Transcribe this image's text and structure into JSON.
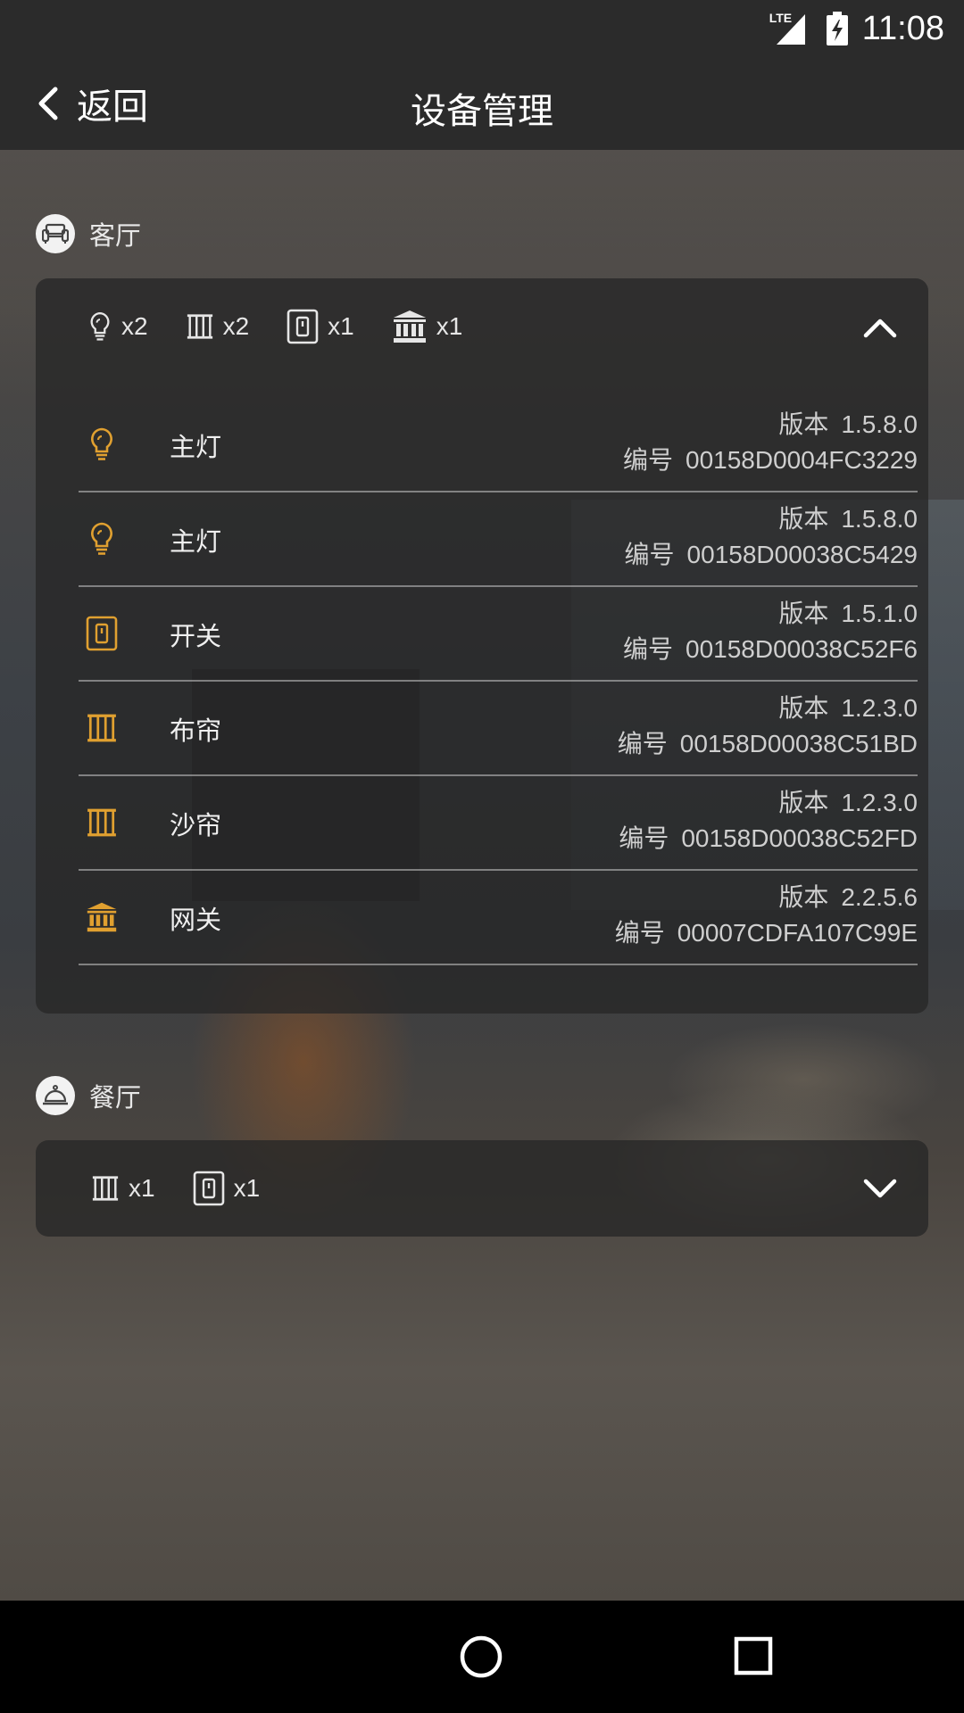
{
  "status_bar": {
    "time": "11:08",
    "network": "LTE"
  },
  "app_bar": {
    "back_label": "返回",
    "title": "设备管理"
  },
  "colors": {
    "accent": "#e0a030",
    "card_bg": "rgba(38,38,38,0.78)"
  },
  "rooms": [
    {
      "name": "客厅",
      "icon": "sofa-icon",
      "expanded": true,
      "summary": [
        {
          "icon": "bulb-icon",
          "count": "x2"
        },
        {
          "icon": "curtain-icon",
          "count": "x2"
        },
        {
          "icon": "switch-icon",
          "count": "x1"
        },
        {
          "icon": "gateway-icon",
          "count": "x1"
        }
      ],
      "devices": [
        {
          "icon": "bulb-icon",
          "name": "主灯",
          "version_label": "版本",
          "version": "1.5.8.0",
          "id_label": "编号",
          "id": "00158D0004FC3229"
        },
        {
          "icon": "bulb-icon",
          "name": "主灯",
          "version_label": "版本",
          "version": "1.5.8.0",
          "id_label": "编号",
          "id": "00158D00038C5429"
        },
        {
          "icon": "switch-icon",
          "name": "开关",
          "version_label": "版本",
          "version": "1.5.1.0",
          "id_label": "编号",
          "id": "00158D00038C52F6"
        },
        {
          "icon": "curtain-icon",
          "name": "布帘",
          "version_label": "版本",
          "version": "1.2.3.0",
          "id_label": "编号",
          "id": "00158D00038C51BD"
        },
        {
          "icon": "curtain-icon",
          "name": "沙帘",
          "version_label": "版本",
          "version": "1.2.3.0",
          "id_label": "编号",
          "id": "00158D00038C52FD"
        },
        {
          "icon": "gateway-icon",
          "name": "网关",
          "version_label": "版本",
          "version": "2.2.5.6",
          "id_label": "编号",
          "id": "00007CDFA107C99E"
        }
      ]
    },
    {
      "name": "餐厅",
      "icon": "dining-bell-icon",
      "expanded": false,
      "summary": [
        {
          "icon": "curtain-icon",
          "count": "x1"
        },
        {
          "icon": "switch-icon",
          "count": "x1"
        }
      ],
      "devices": []
    }
  ]
}
